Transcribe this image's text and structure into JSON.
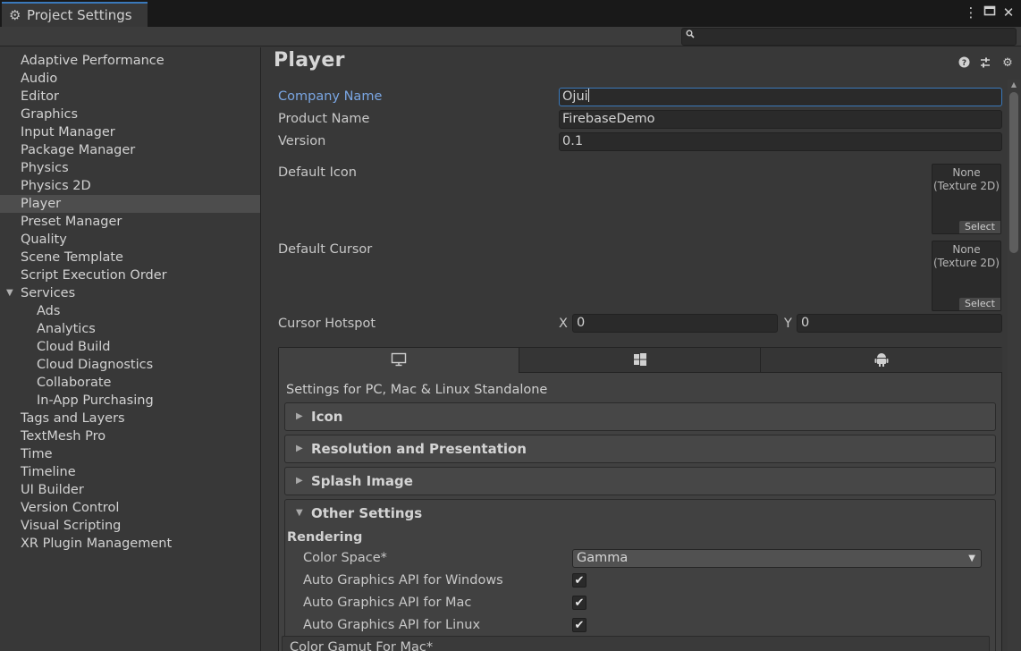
{
  "window": {
    "tab_title": "Project Settings",
    "controls": [
      "more-icon",
      "maximize-icon",
      "close-icon"
    ]
  },
  "search": {
    "placeholder": "",
    "value": ""
  },
  "sidebar": {
    "items": [
      {
        "label": "Adaptive Performance",
        "indent": 0
      },
      {
        "label": "Audio",
        "indent": 0
      },
      {
        "label": "Editor",
        "indent": 0
      },
      {
        "label": "Graphics",
        "indent": 0
      },
      {
        "label": "Input Manager",
        "indent": 0
      },
      {
        "label": "Package Manager",
        "indent": 0
      },
      {
        "label": "Physics",
        "indent": 0
      },
      {
        "label": "Physics 2D",
        "indent": 0
      },
      {
        "label": "Player",
        "indent": 0,
        "selected": true
      },
      {
        "label": "Preset Manager",
        "indent": 0
      },
      {
        "label": "Quality",
        "indent": 0
      },
      {
        "label": "Scene Template",
        "indent": 0
      },
      {
        "label": "Script Execution Order",
        "indent": 0
      },
      {
        "label": "Services",
        "indent": 0,
        "expanded": true
      },
      {
        "label": "Ads",
        "indent": 1
      },
      {
        "label": "Analytics",
        "indent": 1
      },
      {
        "label": "Cloud Build",
        "indent": 1
      },
      {
        "label": "Cloud Diagnostics",
        "indent": 1
      },
      {
        "label": "Collaborate",
        "indent": 1
      },
      {
        "label": "In-App Purchasing",
        "indent": 1
      },
      {
        "label": "Tags and Layers",
        "indent": 0
      },
      {
        "label": "TextMesh Pro",
        "indent": 0
      },
      {
        "label": "Time",
        "indent": 0
      },
      {
        "label": "Timeline",
        "indent": 0
      },
      {
        "label": "UI Builder",
        "indent": 0
      },
      {
        "label": "Version Control",
        "indent": 0
      },
      {
        "label": "Visual Scripting",
        "indent": 0
      },
      {
        "label": "XR Plugin Management",
        "indent": 0
      }
    ]
  },
  "main": {
    "title": "Player",
    "header_icons": [
      "help-icon",
      "presets-icon",
      "settings-gear-icon"
    ],
    "company_name_label": "Company Name",
    "company_name_value": "Ojui",
    "product_name_label": "Product Name",
    "product_name_value": "FirebaseDemo",
    "version_label": "Version",
    "version_value": "0.1",
    "default_icon_label": "Default Icon",
    "default_icon_slot": {
      "line1": "None",
      "line2": "(Texture 2D)",
      "select": "Select"
    },
    "default_cursor_label": "Default Cursor",
    "default_cursor_slot": {
      "line1": "None",
      "line2": "(Texture 2D)",
      "select": "Select"
    },
    "cursor_hotspot_label": "Cursor Hotspot",
    "hotspot_x_label": "X",
    "hotspot_x_value": "0",
    "hotspot_y_label": "Y",
    "hotspot_y_value": "0"
  },
  "platforms": {
    "tabs": [
      "monitor-icon",
      "windows-icon",
      "android-icon"
    ],
    "active_tab": 0,
    "settings_title": "Settings for PC, Mac & Linux Standalone",
    "sections": {
      "icon": "Icon",
      "resolution": "Resolution and Presentation",
      "splash": "Splash Image",
      "other": "Other Settings"
    },
    "other": {
      "rendering_label": "Rendering",
      "color_space_label": "Color Space*",
      "color_space_value": "Gamma",
      "auto_api_windows_label": "Auto Graphics API  for Windows",
      "auto_api_windows_checked": true,
      "auto_api_mac_label": "Auto Graphics API  for Mac",
      "auto_api_mac_checked": true,
      "auto_api_linux_label": "Auto Graphics API  for Linux",
      "auto_api_linux_checked": true,
      "color_gamut_label": "Color Gamut For Mac*"
    }
  }
}
